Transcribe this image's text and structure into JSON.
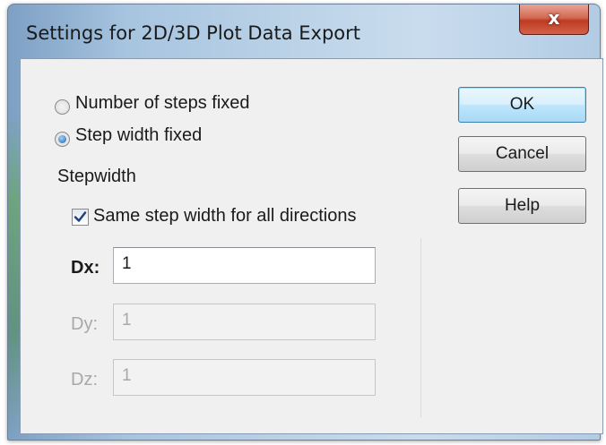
{
  "window": {
    "title": "Settings for 2D/3D Plot Data Export",
    "close_symbol": "x"
  },
  "mode": {
    "options": [
      {
        "label": "Number of steps fixed",
        "selected": false
      },
      {
        "label": "Step width fixed",
        "selected": true
      }
    ]
  },
  "stepwidth": {
    "group_label": "Stepwidth",
    "same_width_label": "Same step width for all directions",
    "same_width_checked": true,
    "fields": [
      {
        "label": "Dx:",
        "value": "1",
        "enabled": true
      },
      {
        "label": "Dy:",
        "value": "1",
        "enabled": false
      },
      {
        "label": "Dz:",
        "value": "1",
        "enabled": false
      }
    ]
  },
  "buttons": {
    "ok": "OK",
    "cancel": "Cancel",
    "help": "Help"
  },
  "colors": {
    "accent": "#3c7fb1",
    "close_red": "#c8462e",
    "disabled_text": "#a8a8a8"
  }
}
